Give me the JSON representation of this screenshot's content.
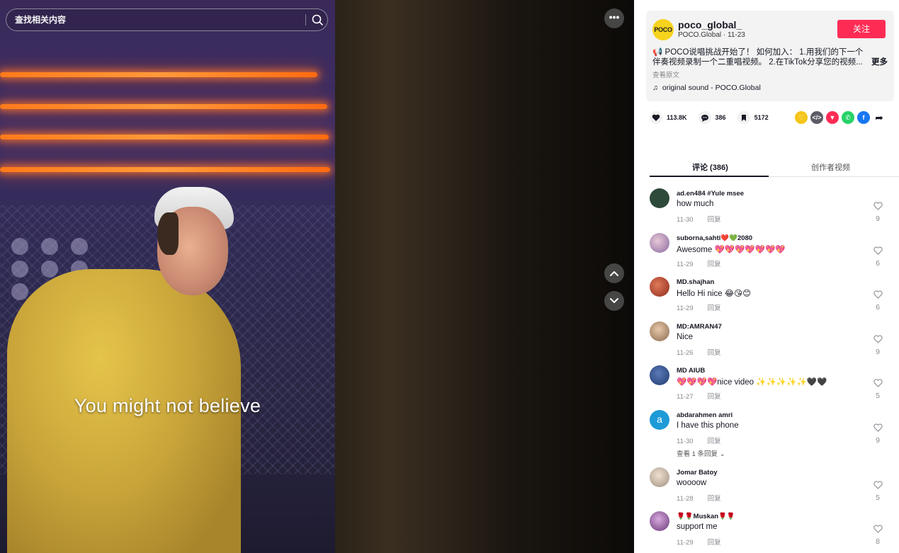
{
  "search": {
    "placeholder": "查找相关内容"
  },
  "video": {
    "caption": "You might not believe"
  },
  "author": {
    "avatar_text": "POCO",
    "username": "poco_global_",
    "subline": "POCO.Global · 11-23",
    "follow_label": "关注"
  },
  "description": {
    "line1": "POCO说唱挑战开始了！ 如何加入： 1.用我们的下一个",
    "line2": "伴奏视频录制一个二重唱视频。 2.在TikTok分享您的视频...",
    "more_label": "更多",
    "translate_label": "查看原文",
    "sound": "original sound - POCO.Global"
  },
  "stats": {
    "likes": "113.8K",
    "comments": "386",
    "saves": "5172"
  },
  "share_icons": [
    "heart-share-icon",
    "embed-icon",
    "send-icon",
    "whatsapp-icon",
    "facebook-icon",
    "share-arrow-icon"
  ],
  "tabs": {
    "comments": "评论 (386)",
    "creator_videos": "创作者视频"
  },
  "reply_label": "回复",
  "comments": [
    {
      "user": "ad.en484 #Yule msee",
      "text": "how much",
      "date": "11-30",
      "likes": "9",
      "avatar_color": "#2e4a3a"
    },
    {
      "user": "suborna,sahti❤️💚2080",
      "text": "Awesome 💖💖💖💖💖💖💖",
      "date": "11-29",
      "likes": "6",
      "avatar_color": "#8a6a9e"
    },
    {
      "user": "MD.shajhan",
      "text": "Hello Hi nice 😂😘😊",
      "date": "11-29",
      "likes": "6",
      "avatar_color": "#c0392b"
    },
    {
      "user": "MD:AMRAN47",
      "text": "Nice",
      "date": "11-26",
      "likes": "9",
      "avatar_color": "#b08a70"
    },
    {
      "user": "MD AIUB",
      "text": "💖💖💖💖nice video ✨✨✨✨✨🖤🖤",
      "date": "11-27",
      "likes": "5",
      "avatar_color": "#1f3a6e"
    },
    {
      "user": "abdarahmen amri",
      "text": "I have this phone",
      "date": "11-30",
      "likes": "9",
      "avatar_color": "#1e9bd7",
      "avatar_letter": "a",
      "view_replies": "查看 1 条回复"
    },
    {
      "user": "Jomar Batoy",
      "text": "woooow",
      "date": "11-28",
      "likes": "5",
      "avatar_color": "#cfcfcf"
    },
    {
      "user": "🌹🌹Muskan🌹🌹",
      "text": "support me",
      "date": "11-29",
      "likes": "8",
      "avatar_color": "#9a5aa8"
    }
  ]
}
